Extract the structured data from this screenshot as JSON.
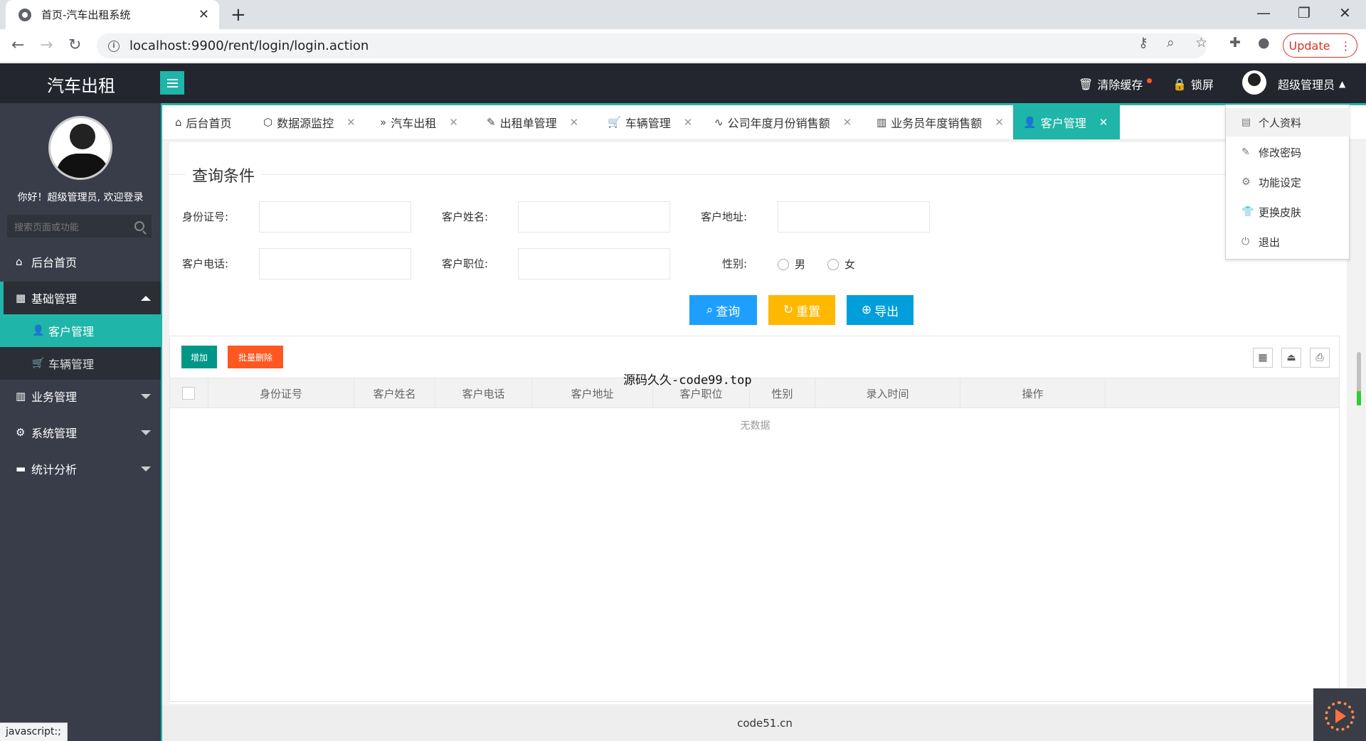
{
  "browser": {
    "tab_title": "首页-汽车出租系统",
    "tab_close": "✕",
    "new_tab": "+",
    "url": "localhost:9900/rent/login/login.action",
    "update_label": "Update"
  },
  "header": {
    "logo": "汽车出租",
    "clear_cache": "清除缓存",
    "lock_screen": "锁屏",
    "user_name": "超级管理员"
  },
  "sidebar": {
    "welcome": "你好！超级管理员, 欢迎登录",
    "search_placeholder": "搜索页面或功能",
    "items": [
      {
        "label": "后台首页",
        "icon": "home-icon"
      },
      {
        "label": "基础管理",
        "icon": "grid-icon"
      },
      {
        "label": "客户管理",
        "icon": "user-icon"
      },
      {
        "label": "车辆管理",
        "icon": "cart-icon"
      },
      {
        "label": "业务管理",
        "icon": "building-icon"
      },
      {
        "label": "系统管理",
        "icon": "gear-icon"
      },
      {
        "label": "统计分析",
        "icon": "monitor-icon"
      }
    ]
  },
  "page_tabs": [
    {
      "label": "后台首页"
    },
    {
      "label": "数据源监控"
    },
    {
      "label": "汽车出租"
    },
    {
      "label": "出租单管理"
    },
    {
      "label": "车辆管理"
    },
    {
      "label": "公司年度月份销售额"
    },
    {
      "label": "业务员年度销售额"
    },
    {
      "label": "客户管理"
    }
  ],
  "query": {
    "title": "查询条件",
    "id_label": "身份证号:",
    "name_label": "客户姓名:",
    "address_label": "客户地址:",
    "phone_label": "客户电话:",
    "job_label": "客户职位:",
    "gender_label": "性别:",
    "male": "男",
    "female": "女",
    "search_btn": "查询",
    "reset_btn": "重置",
    "export_btn": "导出"
  },
  "table": {
    "add_btn": "增加",
    "batch_delete_btn": "批量删除",
    "columns": [
      "身份证号",
      "客户姓名",
      "客户电话",
      "客户地址",
      "客户职位",
      "性别",
      "录入时间",
      "操作"
    ],
    "empty": "无数据"
  },
  "watermark": "源码久久-code99.top",
  "footer": "code51.cn",
  "dropdown": {
    "items": [
      "个人资料",
      "修改密码",
      "功能设定",
      "更换皮肤",
      "退出"
    ]
  },
  "status": "javascript:;"
}
